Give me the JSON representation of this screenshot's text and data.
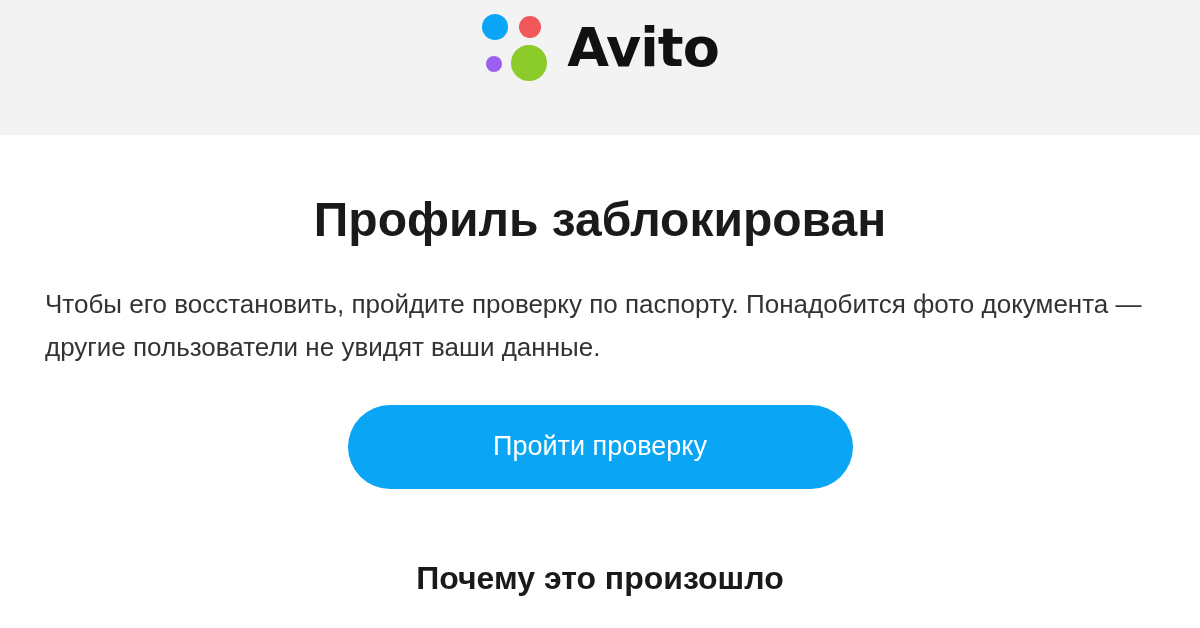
{
  "header": {
    "logo_text": "Avito"
  },
  "title": "Профиль заблокирован",
  "message": "Чтобы его восстановить, пройдите проверку по паспорту. Понадобится фото документа — другие пользователи не увидят ваши данные.",
  "button": {
    "label": "Пройти проверку"
  },
  "subtitle": "Почему это произошло"
}
